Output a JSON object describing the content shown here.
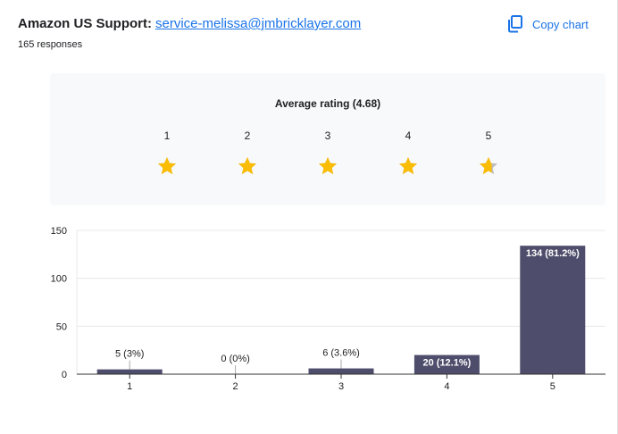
{
  "header": {
    "title": "Amazon US Support:",
    "email": "service-melissa@jmbricklayer.com",
    "responses": "165 responses"
  },
  "copy_chart": {
    "label": "Copy chart",
    "icon": "copy-icon"
  },
  "rating": {
    "title": "Average rating (4.68)",
    "average": 4.68,
    "stars": [
      {
        "label": "1",
        "fill": 1
      },
      {
        "label": "2",
        "fill": 1
      },
      {
        "label": "3",
        "fill": 1
      },
      {
        "label": "4",
        "fill": 1
      },
      {
        "label": "5",
        "fill": 0.68
      }
    ]
  },
  "colors": {
    "star": "#fbbc04",
    "star_empty": "#bdbdbd",
    "bar": "#4e4d6b",
    "link": "#1a73e8"
  },
  "chart_data": {
    "type": "bar",
    "categories": [
      "1",
      "2",
      "3",
      "4",
      "5"
    ],
    "values": [
      5,
      0,
      6,
      20,
      134
    ],
    "data_labels": [
      "5 (3%)",
      "0 (0%)",
      "6 (3.6%)",
      "20 (12.1%)",
      "134 (81.2%)"
    ],
    "ylim": [
      0,
      150
    ],
    "yticks": [
      "0",
      "50",
      "100",
      "150"
    ],
    "ytick_values": [
      0,
      50,
      100,
      150
    ],
    "grid": true
  }
}
